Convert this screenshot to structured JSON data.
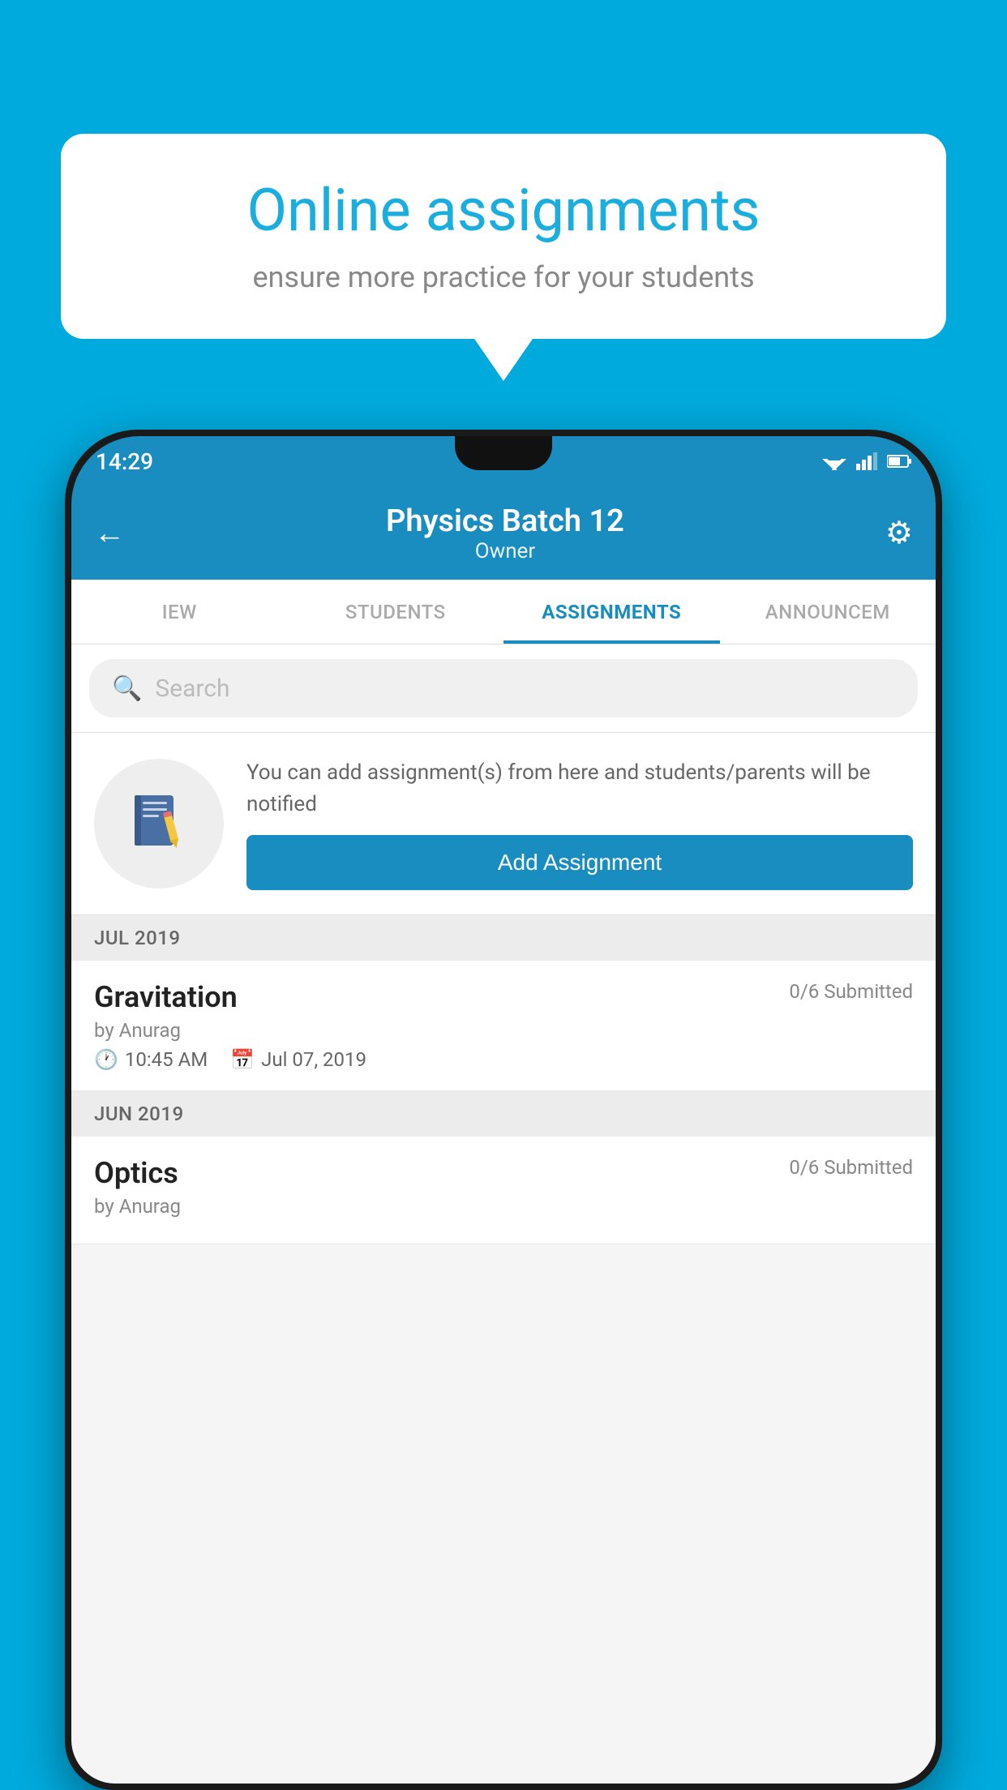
{
  "background": {
    "color": "#00AADD"
  },
  "speech_bubble": {
    "title": "Online assignments",
    "subtitle": "ensure more practice for your students"
  },
  "status_bar": {
    "time": "14:29"
  },
  "app_header": {
    "title": "Physics Batch 12",
    "subtitle": "Owner",
    "back_label": "←",
    "gear_label": "⚙"
  },
  "tabs": [
    {
      "label": "IEW",
      "active": false
    },
    {
      "label": "STUDENTS",
      "active": false
    },
    {
      "label": "ASSIGNMENTS",
      "active": true
    },
    {
      "label": "ANNOUNCEM",
      "active": false
    }
  ],
  "search": {
    "placeholder": "Search"
  },
  "promo": {
    "text": "You can add assignment(s) from here and students/parents will be notified",
    "button_label": "Add Assignment"
  },
  "sections": [
    {
      "header": "JUL 2019",
      "assignments": [
        {
          "name": "Gravitation",
          "submitted": "0/6 Submitted",
          "by": "by Anurag",
          "time": "10:45 AM",
          "date": "Jul 07, 2019"
        }
      ]
    },
    {
      "header": "JUN 2019",
      "assignments": [
        {
          "name": "Optics",
          "submitted": "0/6 Submitted",
          "by": "by Anurag",
          "time": "",
          "date": ""
        }
      ]
    }
  ]
}
